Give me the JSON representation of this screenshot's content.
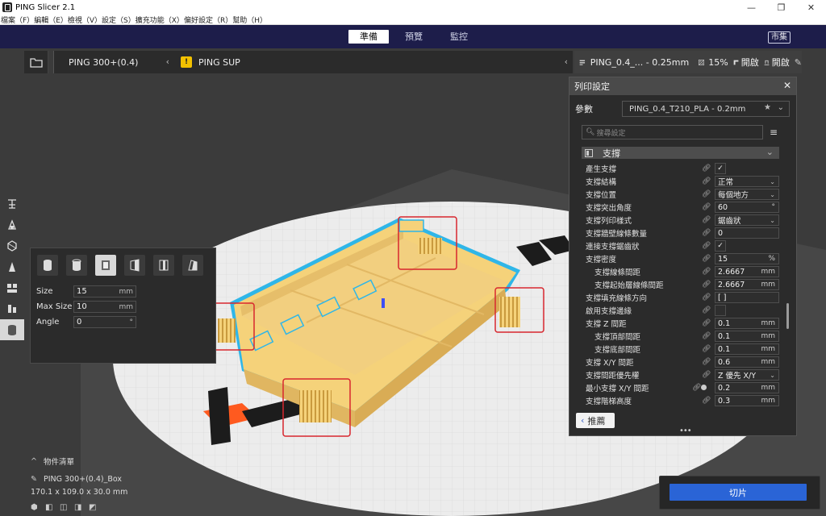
{
  "window": {
    "title": "PING Slicer 2.1",
    "menu": [
      "檔案（F）",
      "編輯（E）",
      "檢視（V）",
      "設定（S）",
      "擴充功能（X）",
      "偏好設定（R）",
      "幫助（H）"
    ],
    "min": "—",
    "max": "❐",
    "close": "✕"
  },
  "stages": {
    "prepare": "準備",
    "preview": "預覽",
    "monitor": "監控",
    "marketplace": "市集"
  },
  "toolbar": {
    "printer": "PING 300+(0.4)",
    "material": "PING SUP",
    "profile": "PING_0.4_... - 0.25mm",
    "infill": "15%",
    "support": "開啟",
    "adhesion": "開啟"
  },
  "panel": {
    "title": "列印設定",
    "profile_label": "參數",
    "profile_value": "PING_0.4_T210_PLA - 0.2mm",
    "search_placeholder": "搜尋設定",
    "category": "支撐",
    "recommend": "推薦",
    "rows": [
      {
        "name": "產生支撐",
        "check": "✓"
      },
      {
        "name": "支撐結構",
        "value": "正常",
        "dd": true
      },
      {
        "name": "支撐位置",
        "value": "每個地方",
        "dd": true
      },
      {
        "name": "支撐突出角度",
        "value": "60",
        "unit": "°"
      },
      {
        "name": "支撐列印樣式",
        "value": "鋸齒狀",
        "dd": true
      },
      {
        "name": "支撐牆壁線條數量",
        "value": "0"
      },
      {
        "name": "連接支撐鋸齒狀",
        "check": "✓"
      },
      {
        "name": "支撐密度",
        "value": "15",
        "unit": "%"
      },
      {
        "name": "支撐線條間距",
        "value": "2.6667",
        "unit": "mm",
        "sub": true
      },
      {
        "name": "支撐起始層線條間距",
        "value": "2.6667",
        "unit": "mm",
        "sub": true
      },
      {
        "name": "支撐填充線條方向",
        "value": "[ ]"
      },
      {
        "name": "啟用支撐邊緣",
        "check": ""
      },
      {
        "name": "支撐 Z 間距",
        "value": "0.1",
        "unit": "mm"
      },
      {
        "name": "支撐頂部間距",
        "value": "0.1",
        "unit": "mm",
        "sub": true
      },
      {
        "name": "支撐底部間距",
        "value": "0.1",
        "unit": "mm",
        "sub": true
      },
      {
        "name": "支撐 X/Y 間距",
        "value": "0.6",
        "unit": "mm"
      },
      {
        "name": "支撐間距優先權",
        "value": "Z 優先 X/Y",
        "dd": true
      },
      {
        "name": "最小支撐 X/Y 間距",
        "value": "0.2",
        "unit": "mm",
        "extra": true
      },
      {
        "name": "支撐階梯高度",
        "value": "0.3",
        "unit": "mm"
      }
    ]
  },
  "blocker": {
    "size_label": "Size",
    "size_value": "15",
    "size_unit": "mm",
    "maxsize_label": "Max Size",
    "maxsize_value": "10",
    "maxsize_unit": "mm",
    "angle_label": "Angle",
    "angle_value": "0"
  },
  "objects": {
    "header": "物件清單",
    "name": "PING 300+(0.4)_Box",
    "dims": "170.1 x 109.0 x 30.0 mm"
  },
  "slice": "切片",
  "colors": {
    "accent": "#2a64d6",
    "stage_bar": "#1d1d4a",
    "model": "#f5d27a",
    "highlight": "#d8262e"
  }
}
